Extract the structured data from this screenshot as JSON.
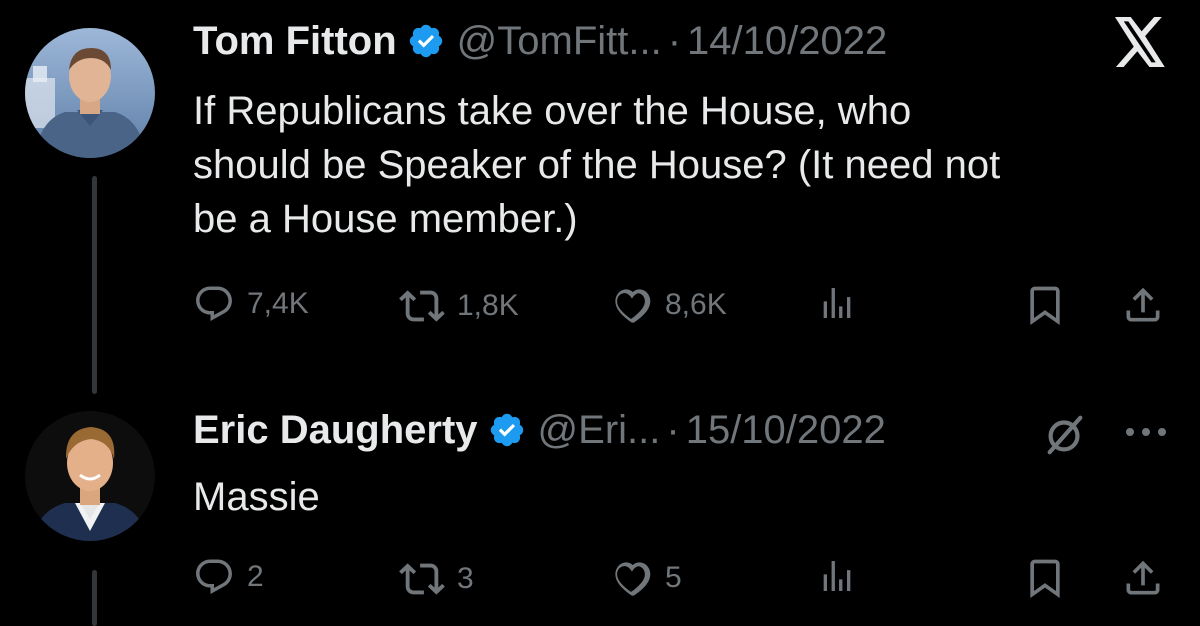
{
  "colors": {
    "background": "#000000",
    "text_primary": "#e7e9ea",
    "text_secondary": "#71767b",
    "verified_blue": "#1d9bf0",
    "thread_line": "#333639"
  },
  "tweets": [
    {
      "author_name": "Tom Fitton",
      "author_handle": "@TomFitt...",
      "separator": "·",
      "date": "14/10/2022",
      "text": "If Republicans take over the House, who\nshould be Speaker of the House? (It need not\nbe a House member.)",
      "replies": "7,4K",
      "retweets": "1,8K",
      "likes": "8,6K",
      "corner_icon": "x-logo-icon",
      "avatar_icon": "avatar-photo-icon"
    },
    {
      "author_name": "Eric Daugherty",
      "author_handle": "@Eri...",
      "separator": "·",
      "date": "15/10/2022",
      "text": "Massie",
      "replies": "2",
      "retweets": "3",
      "likes": "5",
      "corner_icon": "more-options-icon",
      "avatar_icon": "avatar-photo-icon"
    }
  ]
}
